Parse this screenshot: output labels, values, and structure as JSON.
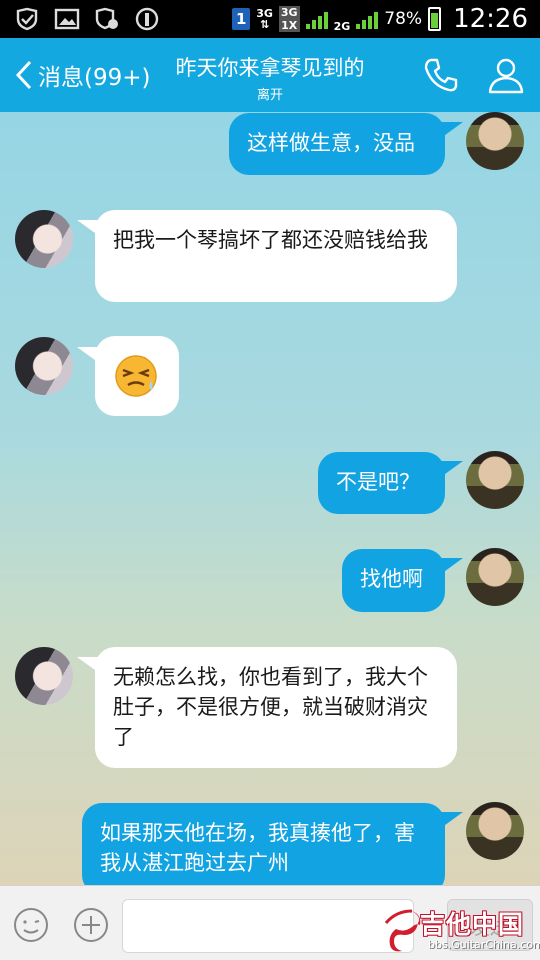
{
  "status_bar": {
    "network_primary": "3G",
    "network_secondary": "3G",
    "network_tertiary": "1X",
    "network_2g": "2G",
    "sim_slot": "1",
    "battery": "78%",
    "time": "12:26",
    "colors": {
      "signal": "#6bd13b"
    }
  },
  "header": {
    "back_label": "消息(99+)",
    "title": "昨天你来拿琴见到的",
    "status": "离开",
    "colors": {
      "bar": "#14a8e0"
    }
  },
  "messages": [
    {
      "from": "me",
      "text": "这样做生意，没品"
    },
    {
      "from": "them",
      "text": "把我一个琴搞坏了都还没赔钱给我"
    },
    {
      "from": "them",
      "type": "emoji",
      "icon": "tired-sweat-face-emoji"
    },
    {
      "from": "me",
      "text": "不是吧？"
    },
    {
      "from": "me",
      "text": "找他啊"
    },
    {
      "from": "them",
      "text": "无赖怎么找，你也看到了，我大个肚子，不是很方便，就当破财消灾了"
    },
    {
      "from": "me",
      "text": "如果那天他在场，我真揍他了，害我从湛江跑过去广州"
    }
  ],
  "input": {
    "placeholder": "",
    "send_label": "发送"
  },
  "watermark": {
    "brand": "吉他中国",
    "url": "bbs.GuitarChina.com"
  },
  "colors": {
    "outgoing_bubble": "#12a3e2",
    "incoming_bubble": "#ffffff"
  }
}
